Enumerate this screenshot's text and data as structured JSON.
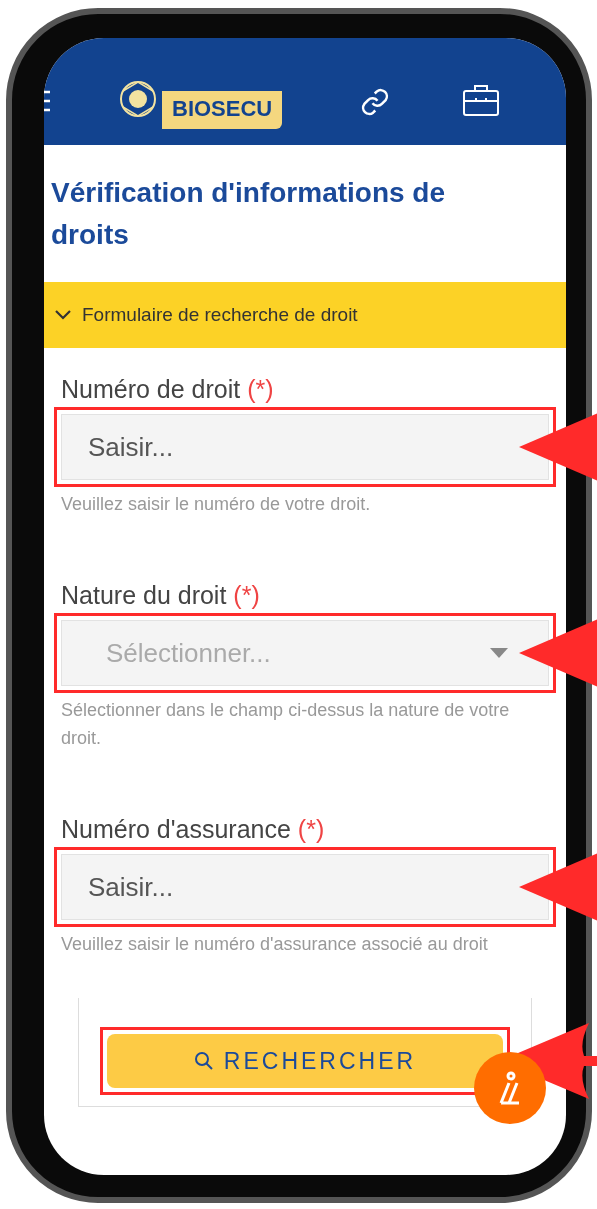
{
  "header": {
    "brand": "BIOSECU"
  },
  "page_title": "Vérification d'informations de droits",
  "section": {
    "title": "Formulaire de recherche de droit",
    "expanded": true
  },
  "fields": [
    {
      "kind": "text",
      "label": "Numéro de droit",
      "required_mark": "(*)",
      "placeholder": "Saisir...",
      "help": "Veuillez saisir le numéro de votre droit."
    },
    {
      "kind": "select",
      "label": "Nature du droit",
      "required_mark": "(*)",
      "placeholder": "Sélectionner...",
      "help": "Sélectionner dans le champ ci-dessus la nature de votre droit."
    },
    {
      "kind": "text",
      "label": "Numéro d'assurance",
      "required_mark": "(*)",
      "placeholder": "Saisir...",
      "help": "Veuillez saisir le numéro d'assurance associé au droit"
    }
  ],
  "search_button": {
    "label": "RECHERCHER"
  }
}
